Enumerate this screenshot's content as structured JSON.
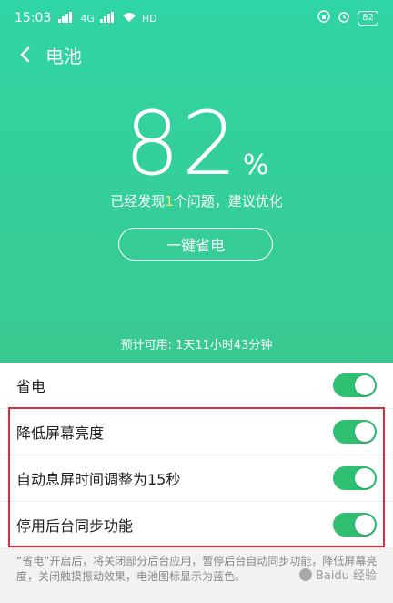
{
  "status_bar": {
    "time": "15:03",
    "network_left": "4G",
    "network_right": "HD",
    "battery": "82"
  },
  "nav": {
    "title": "电池"
  },
  "battery": {
    "percent": "82",
    "percent_sign": "%",
    "issue_prefix": "已经发现",
    "issue_count": "1",
    "issue_suffix": "个问题，建议优化",
    "one_key_button": "一键省电",
    "estimate": "预计可用: 1天11小时43分钟"
  },
  "settings": {
    "items": [
      {
        "label": "省电",
        "enabled": true
      },
      {
        "label": "降低屏幕亮度",
        "enabled": true
      },
      {
        "label": "自动息屏时间调整为15秒",
        "enabled": true
      },
      {
        "label": "停用后台同步功能",
        "enabled": true
      }
    ]
  },
  "footer_note": "“省电”开启后，将关闭部分后台应用，暂停后台自动同步功能，降低屏幕亮度，关闭触摸振动效果，电池图标显示为蓝色。",
  "watermark": "Baidu 经验",
  "colors": {
    "header": "#34cf9b",
    "toggle_on": "#2fbf71",
    "highlight": "#e2283a",
    "issue_number": "#f5e66b"
  }
}
